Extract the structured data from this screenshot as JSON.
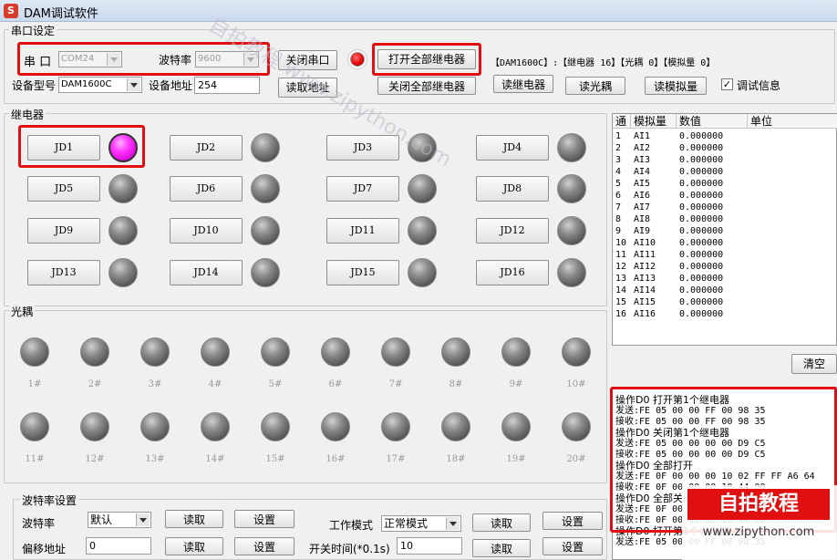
{
  "window": {
    "title": "DAM调试软件"
  },
  "serial": {
    "group_title": "串口设定",
    "port_label": "串 口",
    "port_value": "COM24",
    "baud_label": "波特率",
    "baud_value": "9600",
    "close_port": "关闭串口",
    "open_all": "打开全部继电器",
    "close_all": "关闭全部继电器",
    "device_info": "【DAM1600C】:【继电器 16】【光耦 0】【模拟量 0】",
    "model_label": "设备型号",
    "model_value": "DAM1600C",
    "addr_label": "设备地址",
    "addr_value": "254",
    "read_addr": "读取地址",
    "read_relay": "读继电器",
    "read_opto": "读光耦",
    "read_analog": "读模拟量",
    "debug_label": "调试信息",
    "debug_checked": "✓"
  },
  "relay": {
    "group_title": "继电器",
    "items": [
      {
        "label": "JD1",
        "on": true
      },
      {
        "label": "JD2",
        "on": false
      },
      {
        "label": "JD3",
        "on": false
      },
      {
        "label": "JD4",
        "on": false
      },
      {
        "label": "JD5",
        "on": false
      },
      {
        "label": "JD6",
        "on": false
      },
      {
        "label": "JD7",
        "on": false
      },
      {
        "label": "JD8",
        "on": false
      },
      {
        "label": "JD9",
        "on": false
      },
      {
        "label": "JD10",
        "on": false
      },
      {
        "label": "JD11",
        "on": false
      },
      {
        "label": "JD12",
        "on": false
      },
      {
        "label": "JD13",
        "on": false
      },
      {
        "label": "JD14",
        "on": false
      },
      {
        "label": "JD15",
        "on": false
      },
      {
        "label": "JD16",
        "on": false
      }
    ]
  },
  "opto": {
    "group_title": "光耦",
    "items": [
      "1#",
      "2#",
      "3#",
      "4#",
      "5#",
      "6#",
      "7#",
      "8#",
      "9#",
      "10#",
      "11#",
      "12#",
      "13#",
      "14#",
      "15#",
      "16#",
      "17#",
      "18#",
      "19#",
      "20#"
    ]
  },
  "analog": {
    "headers": [
      "通",
      "模拟量",
      "数值",
      "单位"
    ],
    "rows": [
      [
        "1",
        "AI1",
        "0.000000",
        ""
      ],
      [
        "2",
        "AI2",
        "0.000000",
        ""
      ],
      [
        "3",
        "AI3",
        "0.000000",
        ""
      ],
      [
        "4",
        "AI4",
        "0.000000",
        ""
      ],
      [
        "5",
        "AI5",
        "0.000000",
        ""
      ],
      [
        "6",
        "AI6",
        "0.000000",
        ""
      ],
      [
        "7",
        "AI7",
        "0.000000",
        ""
      ],
      [
        "8",
        "AI8",
        "0.000000",
        ""
      ],
      [
        "9",
        "AI9",
        "0.000000",
        ""
      ],
      [
        "10",
        "AI10",
        "0.000000",
        ""
      ],
      [
        "11",
        "AI11",
        "0.000000",
        ""
      ],
      [
        "12",
        "AI12",
        "0.000000",
        ""
      ],
      [
        "13",
        "AI13",
        "0.000000",
        ""
      ],
      [
        "14",
        "AI14",
        "0.000000",
        ""
      ],
      [
        "15",
        "AI15",
        "0.000000",
        ""
      ],
      [
        "16",
        "AI16",
        "0.000000",
        ""
      ]
    ],
    "clear": "清空"
  },
  "log": {
    "lines": [
      {
        "t": "操作D0  打开第1个继电器",
        "op": true
      },
      {
        "t": "发送:FE 05 00 00 FF 00 98 35",
        "op": false
      },
      {
        "t": "接收:FE 05 00 00 FF 00 98 35",
        "op": false
      },
      {
        "t": "操作D0  关闭第1个继电器",
        "op": true
      },
      {
        "t": "发送:FE 05 00 00 00 00 D9 C5",
        "op": false
      },
      {
        "t": "接收:FE 05 00 00 00 00 D9 C5",
        "op": false
      },
      {
        "t": "操作D0  全部打开",
        "op": true
      },
      {
        "t": "发送:FE 0F 00 00 00 10 02 FF FF A6 64",
        "op": false
      },
      {
        "t": "接收:FE 0F 00 00 00 10 44 00",
        "op": false
      },
      {
        "t": "操作D0  全部关闭",
        "op": true
      },
      {
        "t": "发送:FE 0F 00 00 00 10 02 00 00 E2 00",
        "op": false
      },
      {
        "t": "接收:FE 0F 00 00 00 10 44 00",
        "op": false
      },
      {
        "t": "操作D0  打开第1个继电器",
        "op": true
      },
      {
        "t": "发送:FE 05 00 00 FF 00 98 35",
        "op": false
      }
    ]
  },
  "baudset": {
    "group_title": "波特率设置",
    "baud_label": "波特率",
    "baud_value": "默认",
    "read": "读取",
    "set": "设置",
    "mode_label": "工作模式",
    "mode_value": "正常模式",
    "offset_label": "偏移地址",
    "offset_value": "0",
    "switch_label": "开关时间(*0.1s)",
    "switch_value": "10"
  },
  "watermark": {
    "text1": "自拍教程 www.zipython.com",
    "logo_text": "自拍教程",
    "logo_url": "www.zipython.com"
  }
}
